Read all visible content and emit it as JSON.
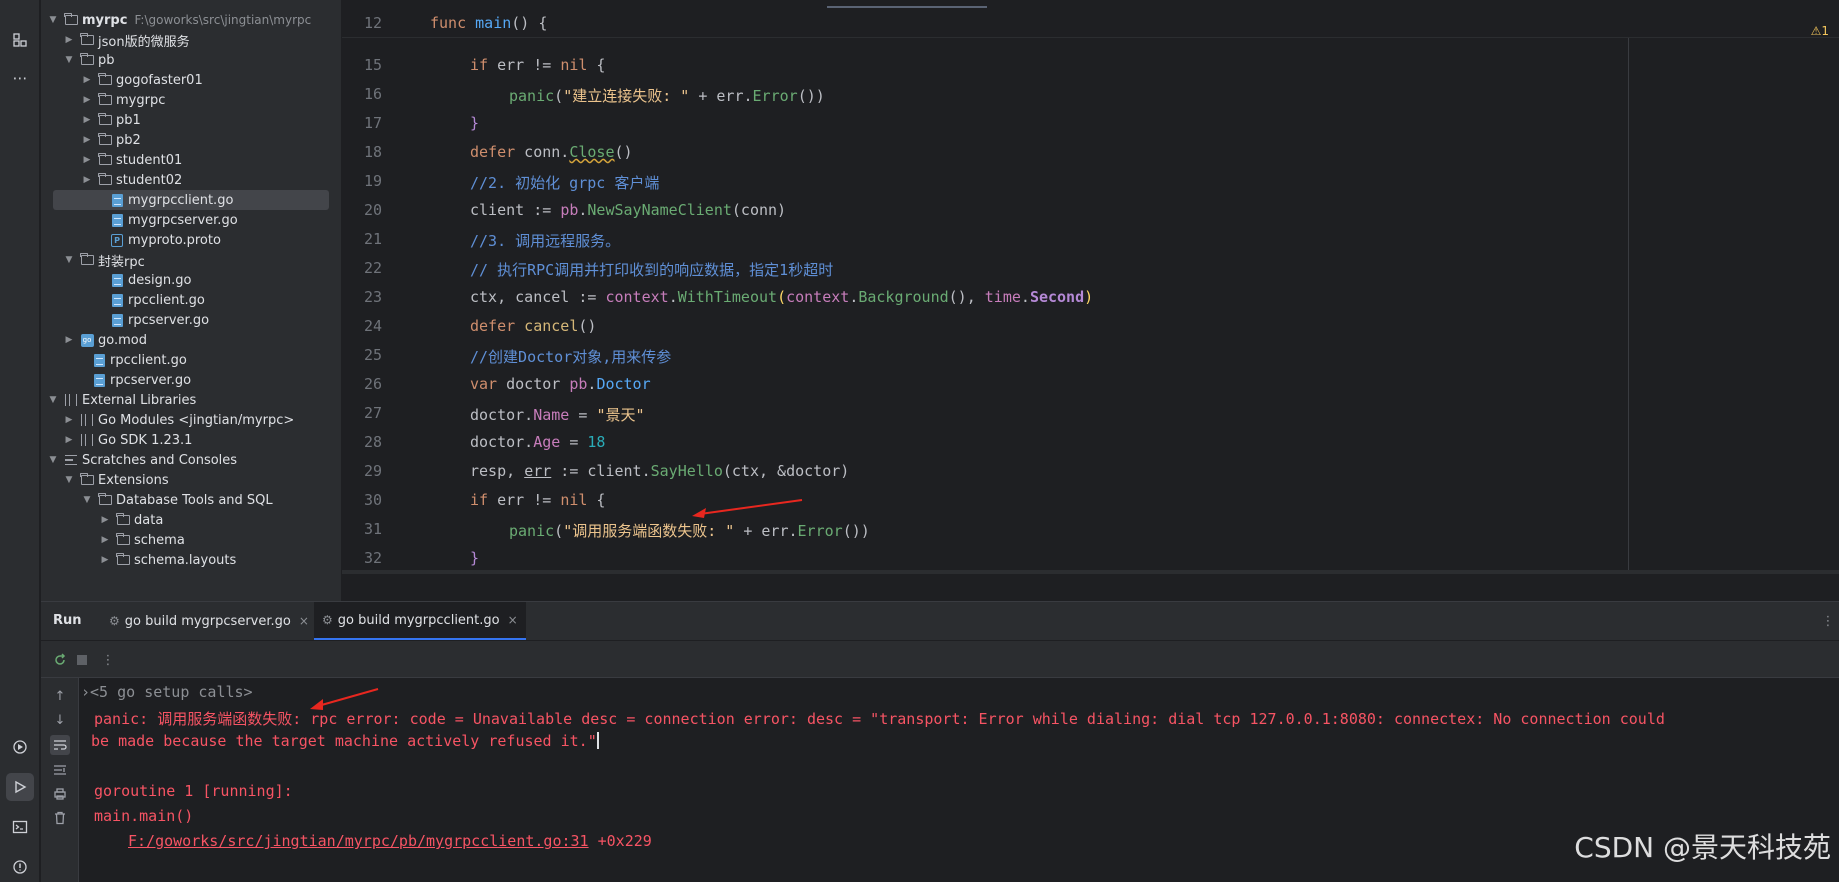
{
  "activity": {
    "icons": [
      "structure-icon",
      "more-icon",
      "services-icon",
      "run-icon",
      "terminal-icon",
      "problems-icon"
    ],
    "more": "⋯"
  },
  "tree": {
    "root": {
      "name": "myrpc",
      "path": "F:\\goworks\\src\\jingtian\\myrpc"
    },
    "items": [
      {
        "label": "json版的微服务"
      },
      {
        "label": "pb"
      },
      {
        "label": "gogofaster01"
      },
      {
        "label": "mygrpc"
      },
      {
        "label": "pb1"
      },
      {
        "label": "pb2"
      },
      {
        "label": "student01"
      },
      {
        "label": "student02"
      },
      {
        "label": "mygrpcclient.go"
      },
      {
        "label": "mygrpcserver.go"
      },
      {
        "label": "myproto.proto"
      },
      {
        "label": "封装rpc"
      },
      {
        "label": "design.go"
      },
      {
        "label": "rpcclient.go"
      },
      {
        "label": "rpcserver.go"
      },
      {
        "label": "go.mod"
      },
      {
        "label": "rpcclient.go"
      },
      {
        "label": "rpcserver.go"
      },
      {
        "label": "External Libraries"
      },
      {
        "label": "Go Modules <jingtian/myrpc>"
      },
      {
        "label": "Go SDK 1.23.1"
      },
      {
        "label": "Scratches and Consoles"
      },
      {
        "label": "Extensions"
      },
      {
        "label": "Database Tools and SQL"
      },
      {
        "label": "data"
      },
      {
        "label": "schema"
      },
      {
        "label": "schema.layouts"
      }
    ]
  },
  "editor": {
    "warning": "⚠1",
    "sticky": {
      "line": "12",
      "kw": "func",
      "name": "main",
      "rest": "() {"
    },
    "line_numbers": [
      "15",
      "16",
      "17",
      "18",
      "19",
      "20",
      "21",
      "22",
      "23",
      "24",
      "25",
      "26",
      "27",
      "28",
      "29",
      "30",
      "31",
      "32"
    ],
    "lines": {
      "l15": {
        "kw": "if",
        "a": " err != ",
        "nil": "nil",
        "b": " {"
      },
      "l16": {
        "fn": "panic",
        "a": "(",
        "str": "\"建立连接失败: \"",
        "b": " + err.",
        "m": "Error",
        "c": "())"
      },
      "l17": {
        "a": "}"
      },
      "l18": {
        "kw": "defer",
        "a": " conn.",
        "m": "Close",
        "b": "()"
      },
      "l19": {
        "cmt": "//2. 初始化 grpc 客户端"
      },
      "l20": {
        "a": "client := ",
        "pkg": "pb",
        "b": ".",
        "fn": "NewSayNameClient",
        "c": "(conn)"
      },
      "l21": {
        "cmt": "//3. 调用远程服务。"
      },
      "l22": {
        "cmt": "// 执行RPC调用并打印收到的响应数据，指定1秒超时"
      },
      "l23": {
        "a": "ctx, cancel := ",
        "p1": "context",
        "b": ".",
        "f1": "WithTimeout",
        "c": "(",
        "p2": "context",
        "d": ".",
        "f2": "Background",
        "e": "(), ",
        "p3": "time",
        "f": ".",
        "k": "Second",
        "g": ")"
      },
      "l24": {
        "kw": "defer",
        "fn": " cancel",
        "a": "()"
      },
      "l25": {
        "cmt": "//创建Doctor对象,用来传参"
      },
      "l26": {
        "kw": "var",
        "a": " doctor ",
        "pkg": "pb",
        "b": ".",
        "t": "Doctor"
      },
      "l27": {
        "a": "doctor.",
        "f": "Name",
        "b": " = ",
        "str": "\"景天\""
      },
      "l28": {
        "a": "doctor.",
        "f": "Age",
        "b": " = ",
        "num": "18"
      },
      "l29": {
        "a": "resp, ",
        "e": "err",
        "b": " := client.",
        "fn": "SayHello",
        "c": "(ctx, &doctor)"
      },
      "l30": {
        "kw": "if",
        "a": " err != ",
        "nil": "nil",
        "b": " {"
      },
      "l31": {
        "fn": "panic",
        "a": "(",
        "str": "\"调用服务端函数失败: \"",
        "b": " + err.",
        "m": "Error",
        "c": "())"
      },
      "l32": {
        "a": "}"
      }
    }
  },
  "run": {
    "title": "Run",
    "tabs": [
      {
        "label": "go build mygrpcserver.go",
        "close": "×"
      },
      {
        "label": "go build mygrpcclient.go",
        "close": "×"
      }
    ],
    "console": {
      "setup": "<5 go setup calls>",
      "panic1": "panic: 调用服务端函数失败: rpc error: code = Unavailable desc = connection error: desc = \"transport: Error while dialing: dial tcp 127.0.0.1:8080: connectex: No connection could",
      "panic2": "be made because the target machine actively refused it.\"",
      "goroutine": "goroutine 1 [running]:",
      "mainmain": "main.main()",
      "link": "F:/goworks/src/jingtian/myrpc/pb/mygrpcclient.go:31",
      "offset": " +0x229"
    }
  },
  "watermark": "CSDN @景天科技苑",
  "colors": {
    "accent": "#3574f0",
    "error": "#f75464",
    "arrow": "#e8271f"
  }
}
